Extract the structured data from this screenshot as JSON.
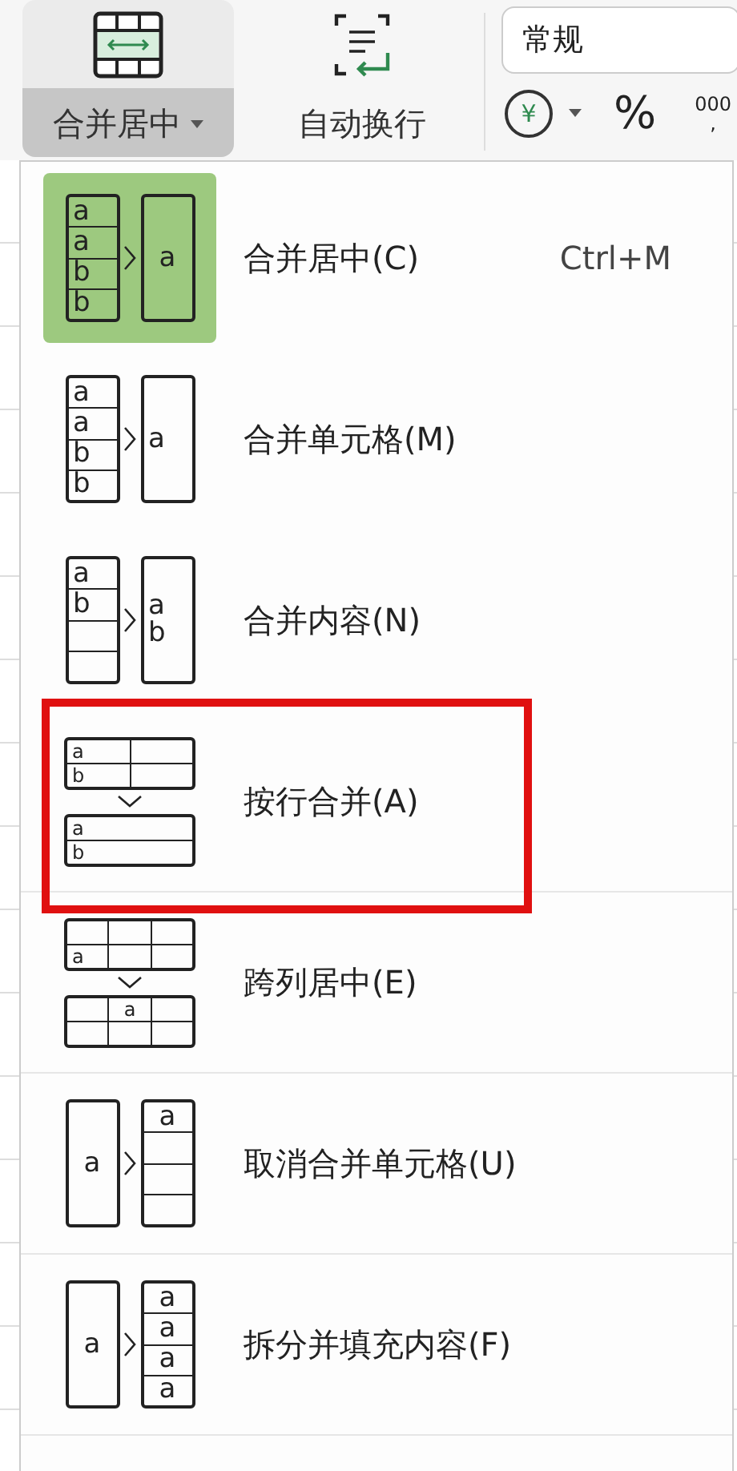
{
  "toolbar": {
    "merge_button": {
      "label": "合并居中",
      "selected": true
    },
    "wrap_button": {
      "label": "自动换行"
    },
    "number_format": {
      "value": "常规"
    },
    "currency": "¥",
    "percent": "%",
    "thousands": "000",
    "thousands_comma": ","
  },
  "menu": {
    "items": [
      {
        "label": "合并居中(C)",
        "shortcut": "Ctrl+M",
        "selected": true,
        "highlighted": false,
        "icon": {
          "kind": "right",
          "before": {
            "centered": false,
            "rows": [
              [
                "a"
              ],
              [
                "a"
              ],
              [
                "b"
              ],
              [
                "b"
              ]
            ]
          },
          "after": {
            "centered": true,
            "rows": [
              [
                "a"
              ]
            ]
          }
        }
      },
      {
        "label": "合并单元格(M)",
        "selected": false,
        "highlighted": false,
        "icon": {
          "kind": "right",
          "before": {
            "centered": false,
            "rows": [
              [
                "a"
              ],
              [
                "a"
              ],
              [
                "b"
              ],
              [
                "b"
              ]
            ]
          },
          "after": {
            "centered": false,
            "rows": [
              [
                "a"
              ]
            ]
          }
        }
      },
      {
        "label": "合并内容(N)",
        "selected": false,
        "highlighted": false,
        "icon": {
          "kind": "right",
          "before": {
            "centered": false,
            "rows": [
              [
                "a"
              ],
              [
                "b"
              ],
              [
                null
              ],
              [
                null
              ]
            ]
          },
          "after": {
            "centered": false,
            "rows": [
              [
                [
                  "a",
                  "b"
                ]
              ]
            ]
          }
        }
      },
      {
        "label": "按行合并(A)",
        "selected": false,
        "highlighted": true,
        "icon": {
          "kind": "down",
          "before": {
            "centered": false,
            "rows": [
              [
                "a",
                null
              ],
              [
                "b",
                null
              ]
            ]
          },
          "after": {
            "centered": false,
            "rows": [
              [
                "a"
              ],
              [
                "b"
              ]
            ]
          }
        }
      },
      {
        "label": "跨列居中(E)",
        "selected": false,
        "highlighted": false,
        "icon": {
          "kind": "down",
          "before": {
            "centered": false,
            "rows": [
              [
                null,
                null,
                null
              ],
              [
                "a",
                null,
                null
              ]
            ]
          },
          "after": {
            "centered": true,
            "rows": [
              [
                null,
                "a",
                null
              ],
              [
                null,
                null,
                null
              ]
            ]
          }
        }
      },
      {
        "label": "取消合并单元格(U)",
        "selected": false,
        "highlighted": false,
        "icon": {
          "kind": "right",
          "before": {
            "centered": true,
            "rows": [
              [
                "a"
              ]
            ]
          },
          "after": {
            "centered": true,
            "rows": [
              [
                "a"
              ],
              [
                null
              ],
              [
                null
              ],
              [
                null
              ]
            ]
          }
        }
      },
      {
        "label": "拆分并填充内容(F)",
        "selected": false,
        "highlighted": false,
        "icon": {
          "kind": "right",
          "before": {
            "centered": true,
            "rows": [
              [
                "a"
              ]
            ]
          },
          "after": {
            "centered": true,
            "rows": [
              [
                "a"
              ],
              [
                "a"
              ],
              [
                "a"
              ],
              [
                "a"
              ]
            ]
          }
        }
      }
    ]
  }
}
